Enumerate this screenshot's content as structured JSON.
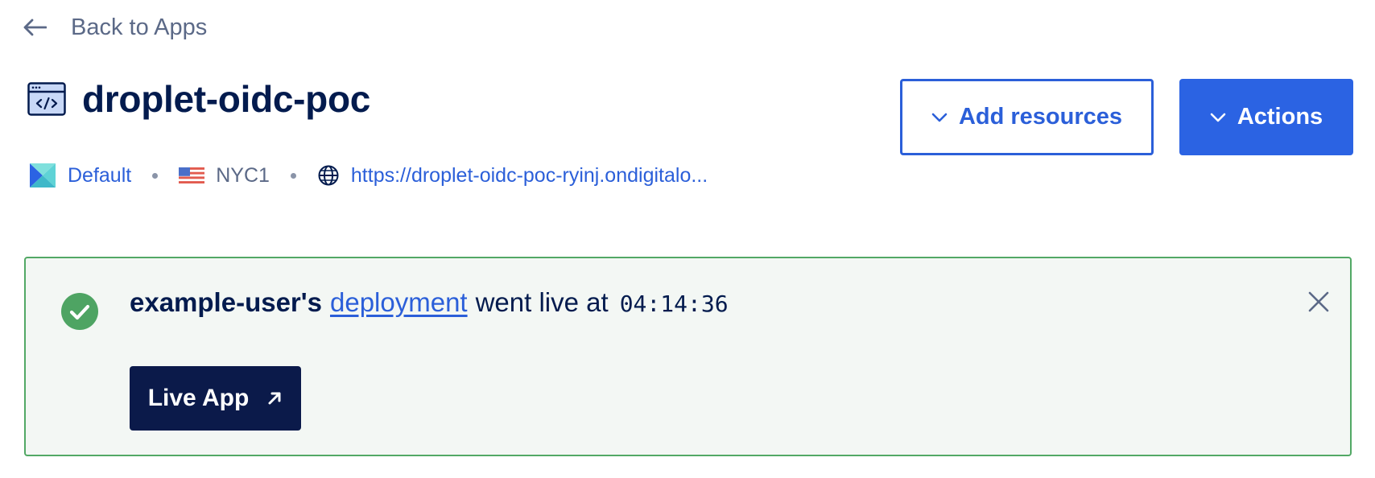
{
  "nav": {
    "back_label": "Back to Apps"
  },
  "header": {
    "title": "droplet-oidc-poc",
    "app_icon": "code-window-icon"
  },
  "meta": {
    "project": "Default",
    "region": "NYC1",
    "url": "https://droplet-oidc-poc-ryinj.ondigitalo..."
  },
  "actions": {
    "add_resources_label": "Add resources",
    "actions_label": "Actions"
  },
  "alert": {
    "user": "example-user's",
    "link_text": "deployment",
    "message": "went live at",
    "time": "04:14:36",
    "live_app_label": "Live App"
  },
  "colors": {
    "accent": "#2b63e3",
    "success": "#52a865",
    "dark_button": "#0b1a4a",
    "title": "#031b4e"
  }
}
